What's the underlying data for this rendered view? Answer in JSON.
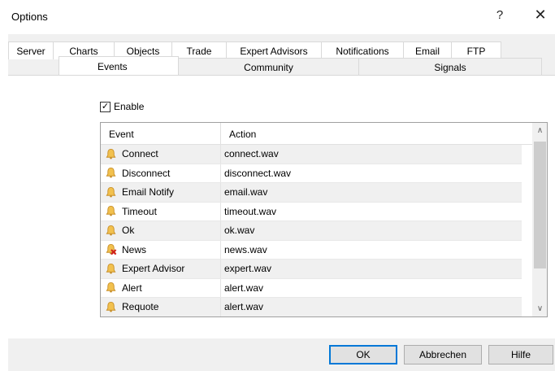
{
  "window": {
    "title": "Options",
    "help_label": "?",
    "close_label": "✕"
  },
  "tabs_row1": [
    "Server",
    "Charts",
    "Objects",
    "Trade",
    "Expert Advisors",
    "Notifications",
    "Email",
    "FTP"
  ],
  "tabs_row2": [
    "Events",
    "Community",
    "Signals"
  ],
  "active_tab": "Events",
  "enable": {
    "label": "Enable",
    "checked": true
  },
  "list": {
    "columns": [
      "Event",
      "Action"
    ],
    "rows": [
      {
        "event": "Connect",
        "action": "connect.wav",
        "icon": "bell-icon"
      },
      {
        "event": "Disconnect",
        "action": "disconnect.wav",
        "icon": "bell-icon"
      },
      {
        "event": "Email Notify",
        "action": "email.wav",
        "icon": "bell-icon"
      },
      {
        "event": "Timeout",
        "action": "timeout.wav",
        "icon": "bell-icon"
      },
      {
        "event": "Ok",
        "action": "ok.wav",
        "icon": "bell-icon"
      },
      {
        "event": "News",
        "action": "news.wav",
        "icon": "bell-disabled-icon"
      },
      {
        "event": "Expert Advisor",
        "action": "expert.wav",
        "icon": "bell-icon"
      },
      {
        "event": "Alert",
        "action": "alert.wav",
        "icon": "bell-icon"
      },
      {
        "event": "Requote",
        "action": "alert.wav",
        "icon": "bell-icon"
      }
    ]
  },
  "buttons": {
    "ok": "OK",
    "cancel": "Abbrechen",
    "help": "Hilfe"
  },
  "colors": {
    "bell": "#f2c14e",
    "bell_outline": "#c8902a",
    "disabled_x": "#d0201a",
    "default_button_border": "#0078d7"
  }
}
